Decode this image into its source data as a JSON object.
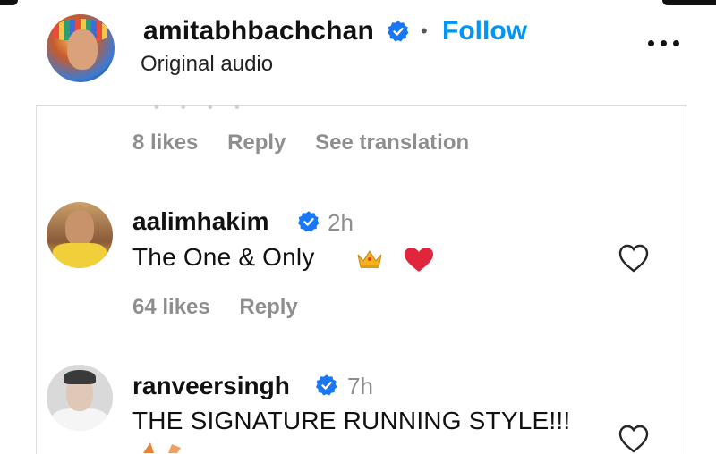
{
  "post_header": {
    "username": "amitabhbachchan",
    "separator": "•",
    "follow_label": "Follow",
    "subtitle": "Original audio",
    "more_icon": "more-horizontal-icon"
  },
  "previous_comment": {
    "likes": "8 likes",
    "reply_label": "Reply",
    "translation_label": "See translation"
  },
  "comments": [
    {
      "username": "aalimhakim",
      "time": "2h",
      "text": "The One & Only",
      "emojis": [
        "crown",
        "red-heart"
      ],
      "likes": "64 likes",
      "reply_label": "Reply"
    },
    {
      "username": "ranveersingh",
      "time": "7h",
      "text": "THE SIGNATURE RUNNING STYLE!!!"
    }
  ],
  "colors": {
    "accent": "#0095f6",
    "muted": "#8e8e8e",
    "verified": "#1877f2",
    "heart": "#e0253c"
  }
}
